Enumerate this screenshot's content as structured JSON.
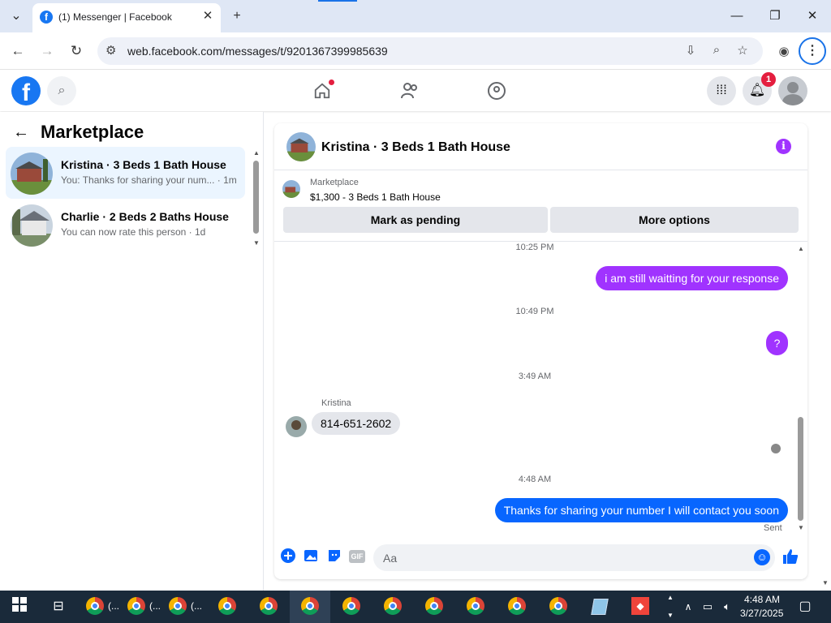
{
  "browser": {
    "tab_title": "(1) Messenger | Facebook",
    "url": "web.facebook.com/messages/t/9201367399985639",
    "new_tab_glyph": "+",
    "close_glyph": "✕",
    "favicon_letter": "f",
    "menu_glyph": "⋮"
  },
  "fb": {
    "logo_letter": "f",
    "notification_count": "1"
  },
  "sidebar": {
    "title": "Marketplace",
    "conversations": [
      {
        "name": "Kristina · 3 Beds 1 Bath House",
        "snippet": "You: Thanks for sharing your num... · 1m",
        "active": true
      },
      {
        "name": "Charlie · 2 Beds 2 Baths House",
        "snippet": "You can now rate this person · 1d",
        "active": false
      }
    ]
  },
  "chat": {
    "title": "Kristina · 3 Beds 1 Bath House",
    "info_glyph": "i",
    "marketplace_label": "Marketplace",
    "listing": "$1,300 - 3 Beds 1 Bath House",
    "mark_pending_label": "Mark as pending",
    "more_options_label": "More options",
    "messages": [
      {
        "time": "10:25 PM"
      },
      {
        "direction": "out",
        "text": "i am still waitting for your response",
        "color": "#a033ff"
      },
      {
        "time": "10:49 PM"
      },
      {
        "direction": "out",
        "text": "?",
        "color": "#a033ff"
      },
      {
        "time": "3:49 AM"
      },
      {
        "direction": "in",
        "sender": "Kristina",
        "text": "814-651-2602"
      },
      {
        "time": "4:48 AM"
      },
      {
        "direction": "out",
        "text": "Thanks for sharing your number I will contact you soon",
        "color": "#0866ff"
      }
    ],
    "status": "Sent",
    "input_placeholder": "Aa",
    "gif_label": "GIF"
  },
  "taskbar": {
    "time": "4:48 AM",
    "date": "3/27/2025",
    "window_labels": [
      "(...",
      "(...",
      "(..."
    ]
  },
  "colors": {
    "brand": "#1877f2",
    "messenger_accent": "#0866ff",
    "purple_bubble": "#a033ff",
    "badge_red": "#e41e3f"
  },
  "icons": {
    "back": "back-arrow-icon",
    "home": "home-icon",
    "friends": "friends-icon",
    "groups": "groups-icon",
    "apps": "apps-grid-icon",
    "notifications": "bell-icon",
    "plus": "plus-icon",
    "image": "image-icon",
    "sticker": "sticker-icon",
    "gif": "gif-icon",
    "emoji": "emoji-icon",
    "like": "thumbs-up-icon"
  }
}
